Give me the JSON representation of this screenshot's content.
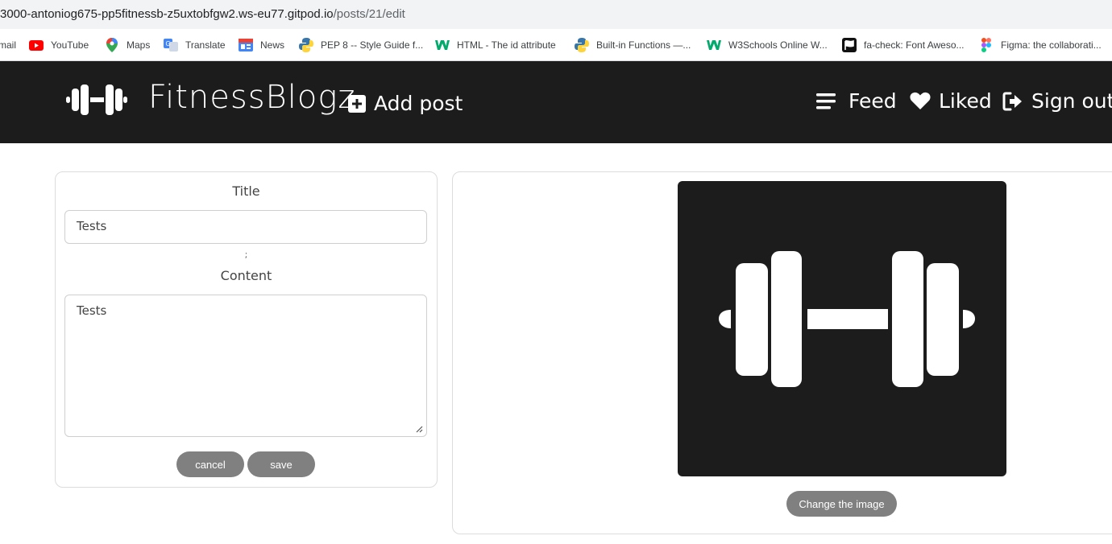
{
  "browser": {
    "url_host": "3000-antoniog675-pp5fitnessb-z5uxtobfgw2.ws-eu77.gitpod.io",
    "url_path": "/posts/21/edit"
  },
  "bookmarks": [
    {
      "label": "mail",
      "icon": "gmail-icon"
    },
    {
      "label": "YouTube",
      "icon": "youtube-icon"
    },
    {
      "label": "Maps",
      "icon": "maps-icon"
    },
    {
      "label": "Translate",
      "icon": "translate-icon"
    },
    {
      "label": "News",
      "icon": "news-icon"
    },
    {
      "label": "PEP 8 -- Style Guide f...",
      "icon": "python-icon"
    },
    {
      "label": "HTML - The id attribute",
      "icon": "w3schools-icon"
    },
    {
      "label": "Built-in Functions —...",
      "icon": "python-icon"
    },
    {
      "label": "W3Schools Online W...",
      "icon": "w3schools-icon"
    },
    {
      "label": "fa-check: Font Aweso...",
      "icon": "fontawesome-icon"
    },
    {
      "label": "Figma: the collaborati...",
      "icon": "figma-icon"
    }
  ],
  "navbar": {
    "brand": "FitnessBlogz",
    "add_post": "Add post",
    "feed": "Feed",
    "liked": "Liked",
    "sign_out": "Sign out"
  },
  "form": {
    "title_label": "Title",
    "title_value": "Tests",
    "separator": ";",
    "content_label": "Content",
    "content_value": "Tests",
    "cancel": "cancel",
    "save": "save"
  },
  "image_panel": {
    "change_image": "Change the image"
  },
  "colors": {
    "navbar_bg": "#1c1c1c",
    "button_bg": "#808080"
  }
}
